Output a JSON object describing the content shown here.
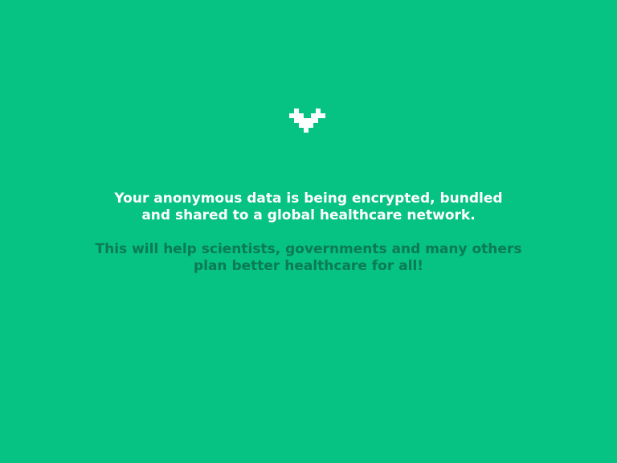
{
  "colors": {
    "background": "#06c283",
    "primary_text": "#ffffff",
    "secondary_text": "#0b7a55",
    "logo": "#ffffff"
  },
  "logo": {
    "icon": "pixel-heart-icon"
  },
  "message": {
    "primary": [
      "Your anonymous data is being encrypted, bundled",
      "and shared to a global healthcare network."
    ],
    "secondary": [
      "This will help scientists, governments and many others",
      "plan better healthcare for all!"
    ]
  }
}
